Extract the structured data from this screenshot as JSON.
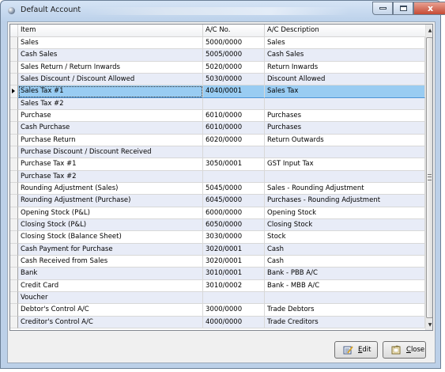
{
  "window": {
    "title": "Default Account"
  },
  "controls": {
    "close_glyph": "x"
  },
  "table": {
    "headers": [
      "Item",
      "A/C No.",
      "A/C Description"
    ],
    "rows": [
      {
        "item": "Sales",
        "acno": "5000/0000",
        "desc": "Sales"
      },
      {
        "item": "Cash Sales",
        "acno": "5005/0000",
        "desc": "Cash Sales"
      },
      {
        "item": "Sales Return / Return Inwards",
        "acno": "5020/0000",
        "desc": "Return Inwards"
      },
      {
        "item": "Sales Discount / Discount Allowed",
        "acno": "5030/0000",
        "desc": "Discount Allowed"
      },
      {
        "item": "Sales Tax #1",
        "acno": "4040/0001",
        "desc": "Sales Tax"
      },
      {
        "item": "Sales Tax #2",
        "acno": "",
        "desc": ""
      },
      {
        "item": "Purchase",
        "acno": "6010/0000",
        "desc": "Purchases"
      },
      {
        "item": "Cash Purchase",
        "acno": "6010/0000",
        "desc": "Purchases"
      },
      {
        "item": "Purchase Return",
        "acno": "6020/0000",
        "desc": "Return Outwards"
      },
      {
        "item": "Purchase Discount / Discount Received",
        "acno": "",
        "desc": ""
      },
      {
        "item": "Purchase Tax #1",
        "acno": "3050/0001",
        "desc": "GST Input Tax"
      },
      {
        "item": "Purchase Tax #2",
        "acno": "",
        "desc": ""
      },
      {
        "item": "Rounding Adjustment (Sales)",
        "acno": "5045/0000",
        "desc": "Sales - Rounding Adjustment"
      },
      {
        "item": "Rounding Adjustment (Purchase)",
        "acno": "6045/0000",
        "desc": "Purchases - Rounding Adjustment"
      },
      {
        "item": "Opening Stock (P&L)",
        "acno": "6000/0000",
        "desc": "Opening Stock"
      },
      {
        "item": "Closing Stock (P&L)",
        "acno": "6050/0000",
        "desc": "Closing Stock"
      },
      {
        "item": "Closing Stock (Balance Sheet)",
        "acno": "3030/0000",
        "desc": "Stock"
      },
      {
        "item": "Cash Payment for Purchase",
        "acno": "3020/0001",
        "desc": "Cash"
      },
      {
        "item": "Cash Received from Sales",
        "acno": "3020/0001",
        "desc": "Cash"
      },
      {
        "item": "Bank",
        "acno": "3010/0001",
        "desc": "Bank - PBB A/C"
      },
      {
        "item": "Credit Card",
        "acno": "3010/0002",
        "desc": "Bank - MBB A/C"
      },
      {
        "item": "Voucher",
        "acno": "",
        "desc": ""
      },
      {
        "item": "Debtor's Control A/C",
        "acno": "3000/0000",
        "desc": "Trade Debtors"
      },
      {
        "item": "Creditor's Control A/C",
        "acno": "4000/0000",
        "desc": "Trade Creditors"
      }
    ],
    "selected_row": "Sales Tax #1"
  },
  "buttons": {
    "edit": {
      "mnemonic": "E",
      "rest": "dit"
    },
    "close": {
      "mnemonic": "C",
      "rest": "lose"
    }
  },
  "colors": {
    "selection": "#99ccf2",
    "alt_row": "#e8ecf7",
    "window_frame": "#bcd0e8"
  },
  "icons": [
    "app-icon",
    "minimize-icon",
    "maximize-icon",
    "close-icon",
    "edit-icon",
    "close-door-icon",
    "row-pointer-icon",
    "scroll-up-icon",
    "scroll-down-icon"
  ]
}
